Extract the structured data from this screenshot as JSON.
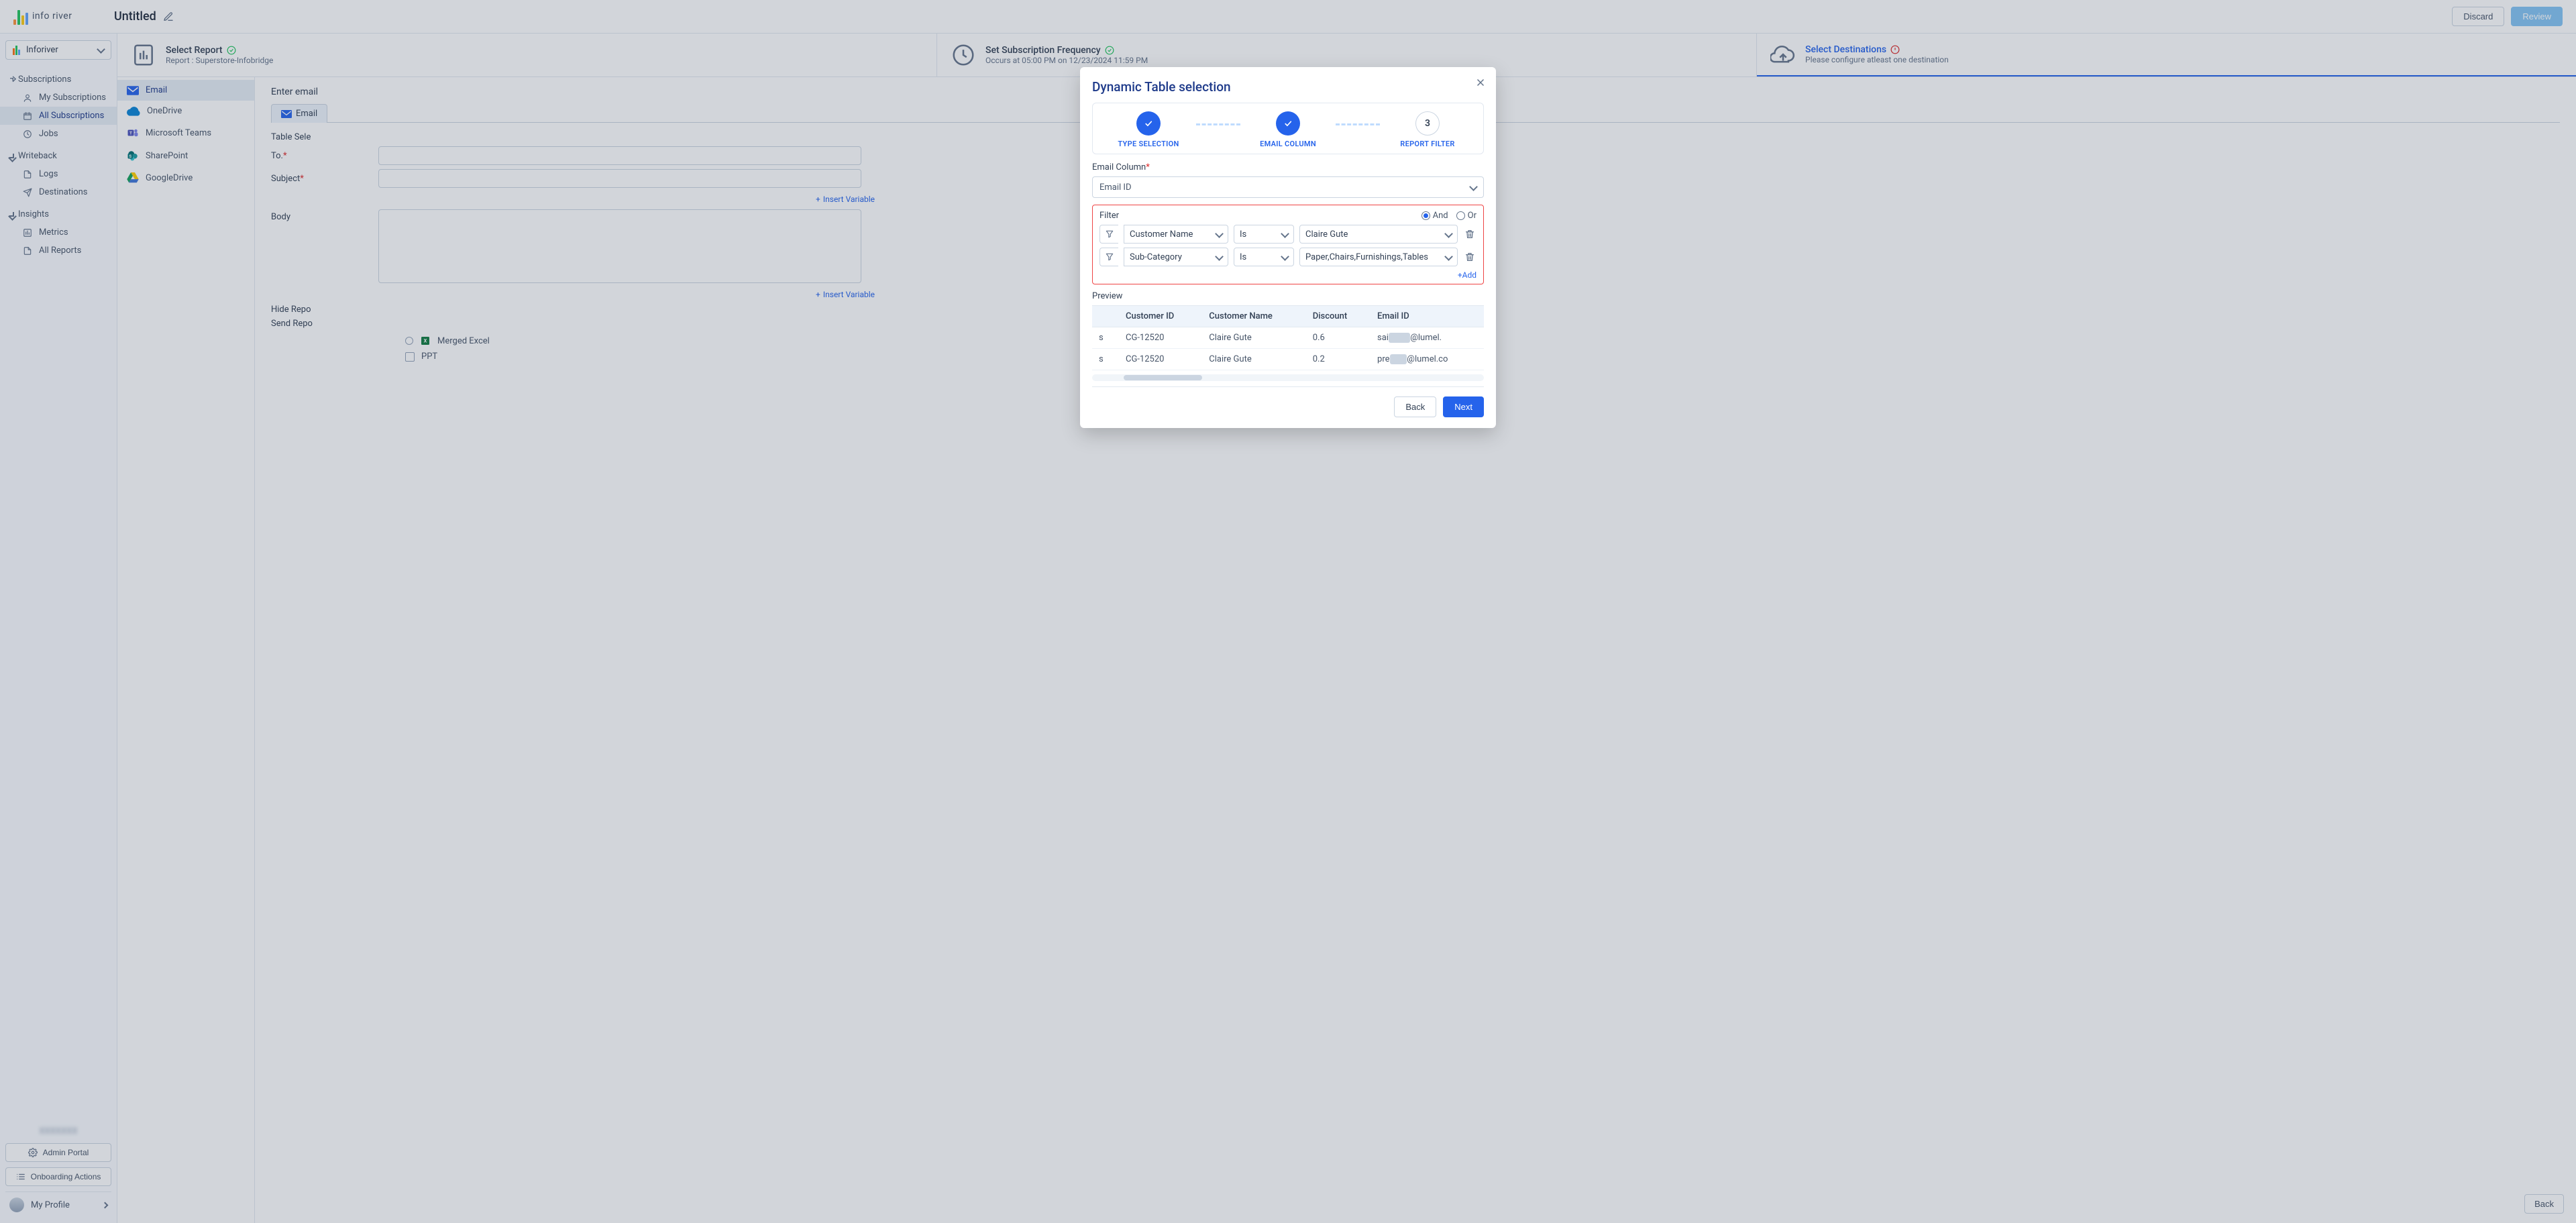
{
  "brand": {
    "name": "info river"
  },
  "doc_title": "Untitled",
  "workspace_selector": "Inforiver",
  "header_buttons": {
    "discard": "Discard",
    "review": "Review"
  },
  "sidebar": {
    "sections": [
      {
        "label": "Subscriptions",
        "items": [
          {
            "label": "My Subscriptions"
          },
          {
            "label": "All Subscriptions",
            "active": true
          },
          {
            "label": "Jobs"
          }
        ]
      },
      {
        "label": "Writeback",
        "items": [
          {
            "label": "Logs"
          },
          {
            "label": "Destinations"
          }
        ]
      },
      {
        "label": "Insights",
        "items": [
          {
            "label": "Metrics"
          },
          {
            "label": "All Reports"
          }
        ]
      }
    ],
    "buttons": {
      "admin": "Admin Portal",
      "onboarding": "Onboarding Actions",
      "blurred": "XXXXXXX"
    },
    "profile": "My Profile"
  },
  "steps": {
    "select_report": {
      "title": "Select Report",
      "sub": "Report : Superstore-Infobridge"
    },
    "freq": {
      "title": "Set Subscription Frequency",
      "sub": "Occurs at 05:00 PM on 12/23/2024 11:59 PM"
    },
    "dest": {
      "title": "Select Destinations",
      "sub": "Please configure atleast one destination"
    }
  },
  "destinations": {
    "items": [
      {
        "label": "Email",
        "active": true
      },
      {
        "label": "OneDrive"
      },
      {
        "label": "Microsoft Teams"
      },
      {
        "label": "SharePoint"
      },
      {
        "label": "GoogleDrive"
      }
    ]
  },
  "form": {
    "heading": "Enter email",
    "email_tab": "Email",
    "labels": {
      "table_sel": "Table Sele",
      "to": "To.",
      "subject": "Subject",
      "body": "Body",
      "hide": "Hide Repo",
      "send": "Send Repo"
    },
    "insert_variable": "Insert Variable",
    "attachments": {
      "merged_excel": "Merged Excel",
      "ppt": "PPT"
    }
  },
  "footer": {
    "back": "Back"
  },
  "modal": {
    "title": "Dynamic Table selection",
    "wizard": {
      "step1": "TYPE SELECTION",
      "step2": "EMAIL COLUMN",
      "step3_num": "3",
      "step3": "REPORT FILTER"
    },
    "email_col_label": "Email Column",
    "email_col_value": "Email ID",
    "filter_label": "Filter",
    "andor": {
      "and": "And",
      "or": "Or"
    },
    "rows": [
      {
        "column": "Customer Name",
        "op": "Is",
        "value": "Claire Gute"
      },
      {
        "column": "Sub-Category",
        "op": "Is",
        "value": "Paper,Chairs,Furnishings,Tables"
      }
    ],
    "add": "+Add",
    "preview_label": "Preview",
    "table": {
      "headers": {
        "c0": "",
        "c1": "Customer ID",
        "c2": "Customer Name",
        "c3": "Discount",
        "c4": "Email ID"
      },
      "r0": {
        "c0": "s",
        "c1": "CG-12520",
        "c2": "Claire Gute",
        "c3": "0.6",
        "c4a": "sai",
        "c4b": "@lumel."
      },
      "r1": {
        "c0": "s",
        "c1": "CG-12520",
        "c2": "Claire Gute",
        "c3": "0.2",
        "c4a": "pre",
        "c4b": "@lumel.co"
      }
    },
    "buttons": {
      "back": "Back",
      "next": "Next"
    }
  }
}
